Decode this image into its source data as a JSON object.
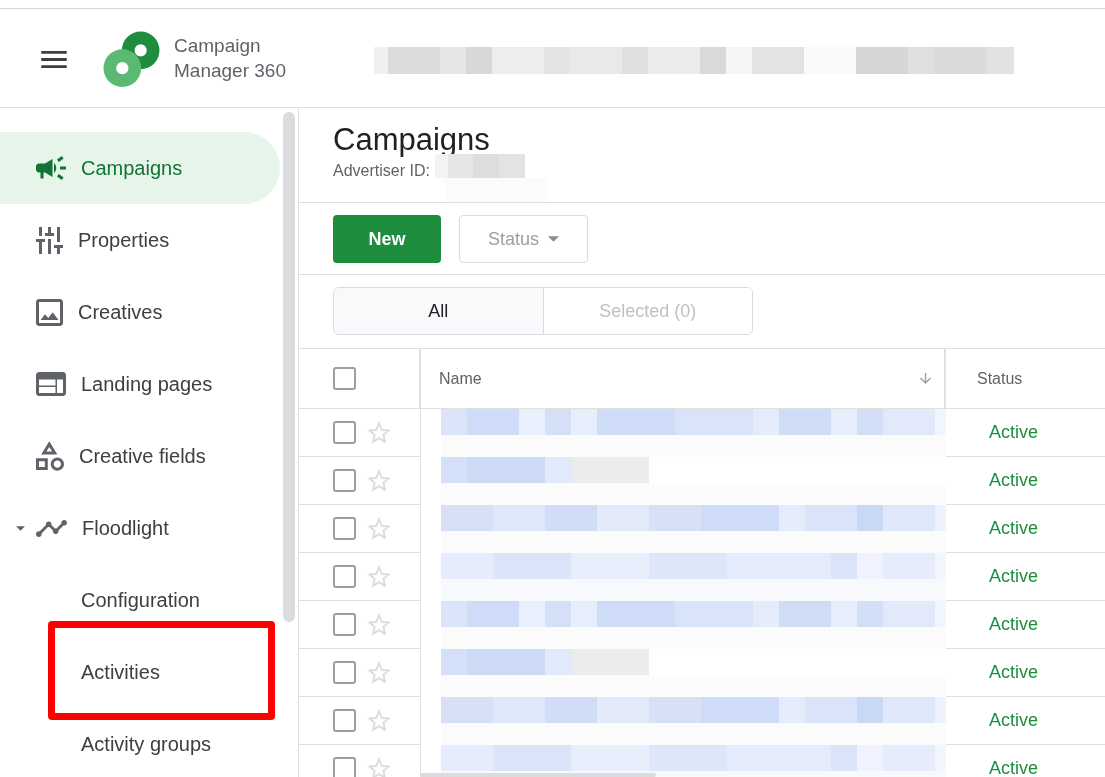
{
  "header": {
    "app_name": "Campaign Manager 360",
    "account_redacted": true
  },
  "sidebar": {
    "items": [
      {
        "label": "Campaigns",
        "selected": true,
        "highlighted": false
      },
      {
        "label": "Properties",
        "selected": false,
        "highlighted": false
      },
      {
        "label": "Creatives",
        "selected": false,
        "highlighted": false
      },
      {
        "label": "Landing pages",
        "selected": false,
        "highlighted": false
      },
      {
        "label": "Creative fields",
        "selected": false,
        "highlighted": false
      },
      {
        "label": "Floodlight",
        "selected": false,
        "highlighted": false,
        "expanded": true,
        "children": [
          {
            "label": "Configuration",
            "selected": false,
            "highlighted": false
          },
          {
            "label": "Activities",
            "selected": false,
            "highlighted": true
          },
          {
            "label": "Activity groups",
            "selected": false,
            "highlighted": false
          }
        ]
      }
    ]
  },
  "page": {
    "title": "Campaigns",
    "advertiser_label": "Advertiser ID:",
    "advertiser_id_redacted": true
  },
  "toolbar": {
    "buttons": [
      {
        "label": "New",
        "kind": "primary"
      },
      {
        "label": "Status",
        "kind": "dropdown"
      }
    ]
  },
  "view_tabs": [
    {
      "label": "All",
      "selected": true
    },
    {
      "label": "Selected (0)",
      "selected": false
    }
  ],
  "table": {
    "select_all": {
      "checked": false
    },
    "columns": [
      {
        "label": "Name",
        "sorted": true
      },
      {
        "label": "Status",
        "sorted": false
      }
    ],
    "rows": [
      {
        "checked": false,
        "starred": false,
        "name_redacted": true,
        "status": "Active"
      },
      {
        "checked": false,
        "starred": false,
        "name_redacted": true,
        "status": "Active"
      },
      {
        "checked": false,
        "starred": false,
        "name_redacted": true,
        "status": "Active"
      },
      {
        "checked": false,
        "starred": false,
        "name_redacted": true,
        "status": "Active"
      },
      {
        "checked": false,
        "starred": false,
        "name_redacted": true,
        "status": "Active"
      },
      {
        "checked": false,
        "starred": false,
        "name_redacted": true,
        "status": "Active"
      },
      {
        "checked": false,
        "starred": false,
        "name_redacted": true,
        "status": "Active"
      },
      {
        "checked": false,
        "starred": false,
        "name_redacted": true,
        "status": "Active"
      }
    ]
  }
}
